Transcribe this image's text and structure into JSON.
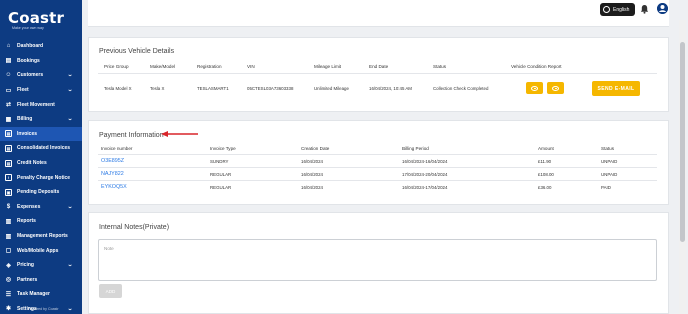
{
  "brand": {
    "logo_text": "Coastr",
    "tagline": "Make your own way"
  },
  "topbar": {
    "language_label": "English"
  },
  "sidebar": {
    "items": [
      {
        "label": "Dashboard",
        "icon": "house-icon",
        "chevron": false,
        "sub": false
      },
      {
        "label": "Bookings",
        "icon": "book-icon",
        "chevron": false,
        "sub": false
      },
      {
        "label": "Customers",
        "icon": "users-icon",
        "chevron": true,
        "sub": false
      },
      {
        "label": "Fleet",
        "icon": "car-icon",
        "chevron": true,
        "sub": false
      },
      {
        "label": "Fleet Movement",
        "icon": "move-icon",
        "chevron": false,
        "sub": false
      },
      {
        "label": "Billing",
        "icon": "billing-icon",
        "chevron": true,
        "sub": false
      },
      {
        "label": "Invoices",
        "icon": "invoice-icon",
        "chevron": false,
        "sub": true,
        "active": true
      },
      {
        "label": "Consolidated Invoices",
        "icon": "invoice-icon",
        "chevron": false,
        "sub": true
      },
      {
        "label": "Credit Notes",
        "icon": "credit-note-icon",
        "chevron": false,
        "sub": true
      },
      {
        "label": "Penalty Charge Notice",
        "icon": "penalty-icon",
        "chevron": false,
        "sub": true
      },
      {
        "label": "Pending Deposits",
        "icon": "deposit-icon",
        "chevron": false,
        "sub": true
      },
      {
        "label": "Expenses",
        "icon": "expenses-icon",
        "chevron": true,
        "sub": false
      },
      {
        "label": "Reports",
        "icon": "reports-icon",
        "chevron": false,
        "sub": false
      },
      {
        "label": "Management Reports",
        "icon": "chart-icon",
        "chevron": false,
        "sub": false
      },
      {
        "label": "Web/Mobile Apps",
        "icon": "apps-icon",
        "chevron": false,
        "sub": false
      },
      {
        "label": "Pricing",
        "icon": "pricing-icon",
        "chevron": true,
        "sub": false
      },
      {
        "label": "Partners",
        "icon": "partners-icon",
        "chevron": false,
        "sub": false
      },
      {
        "label": "Task Manager",
        "icon": "tasks-icon",
        "chevron": false,
        "sub": false
      },
      {
        "label": "Settings",
        "icon": "gear-icon",
        "chevron": true,
        "sub": false
      }
    ],
    "powered_by": "Powered by Coastr"
  },
  "previous_vehicle": {
    "title": "Previous Vehicle Details",
    "headers": [
      "Price Group",
      "Make/Model",
      "Registration",
      "VIN",
      "Mileage Limit",
      "End Date",
      "Status",
      "Vehicle Condition Report"
    ],
    "row": [
      "Tesla Model X",
      "Tesla X",
      "TESLASMART1",
      "05CTESL03A73603338",
      "Unlimited Mileage",
      "16/04/2024, 10:45 AM",
      "Collection Check Completed"
    ],
    "email_button": "SEND E-MAIL"
  },
  "payment": {
    "title": "Payment Information",
    "headers": [
      "Invoice number",
      "Invoice Type",
      "Creation Date",
      "Billing Period",
      "Amount",
      "Status"
    ],
    "rows": [
      [
        "O3E895Z",
        "SUNDRY",
        "16/04/2024",
        "16/04/2024-16/04/2024",
        "£11.90",
        "UNPAID"
      ],
      [
        "NAJY822",
        "REGULAR",
        "16/04/2024",
        "17/04/2024-20/04/2024",
        "£108.00",
        "UNPAID"
      ],
      [
        "EYKOQ5X",
        "REGULAR",
        "16/04/2024",
        "16/04/2024-17/04/2024",
        "£36.00",
        "PAID"
      ]
    ]
  },
  "notes": {
    "title": "Internal Notes(Private)",
    "placeholder": "Note",
    "add_button": "ADD"
  },
  "colors": {
    "sidebar": "#0d3b82",
    "accent": "#f5b700",
    "link": "#2d7be5",
    "arrow": "#d9252a"
  }
}
